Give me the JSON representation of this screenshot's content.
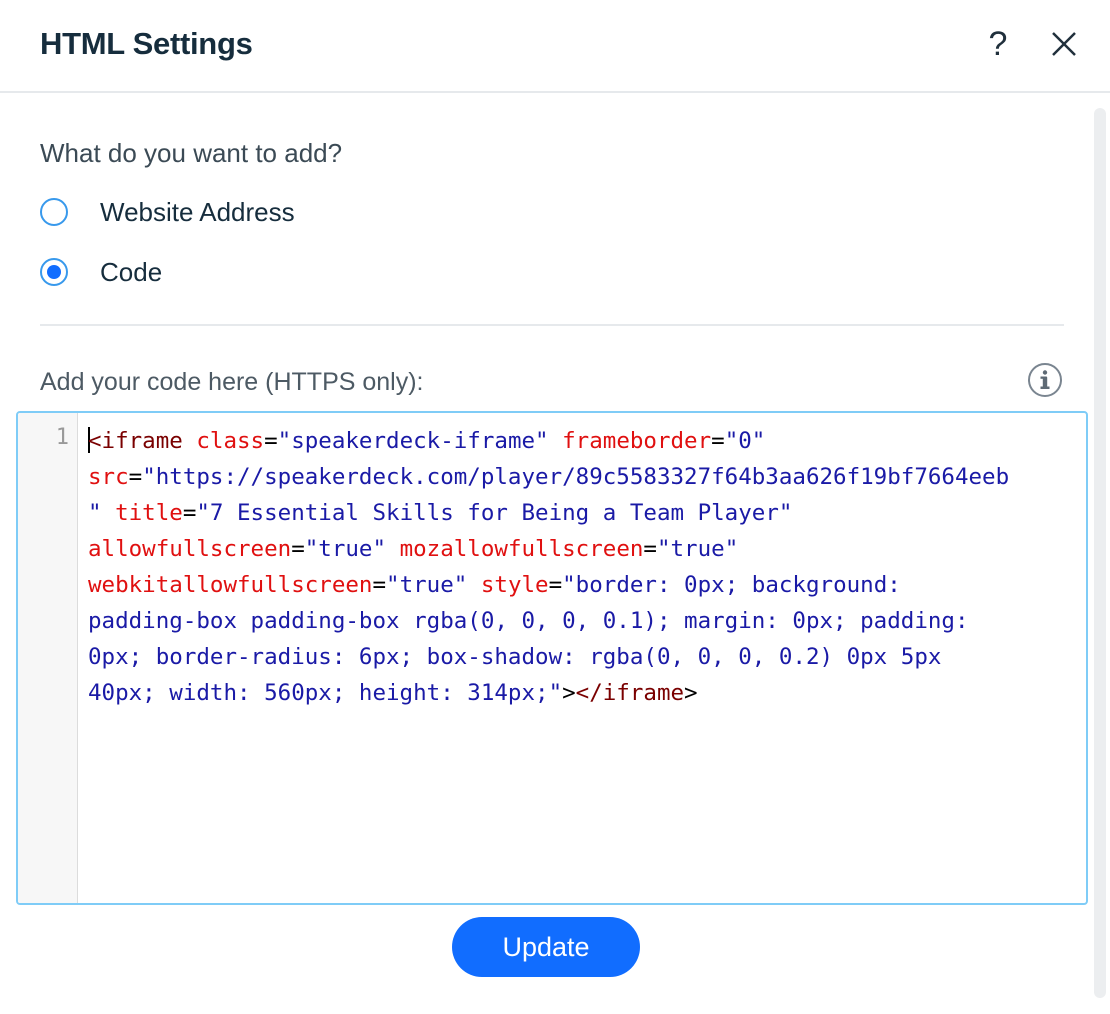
{
  "dialog": {
    "title": "HTML Settings",
    "help_icon": "question-icon",
    "help_label": "?",
    "close_icon": "close-icon"
  },
  "content": {
    "question": "What do you want to add?",
    "options": [
      {
        "label": "Website Address",
        "selected": false
      },
      {
        "label": "Code",
        "selected": true
      }
    ],
    "code_label": "Add your code here (HTTPS only):",
    "info_icon": "info-icon"
  },
  "editor": {
    "line_number": "1",
    "lines": [
      [
        {
          "t": "tag",
          "v": "<iframe"
        },
        {
          "t": "punct",
          "v": " "
        },
        {
          "t": "attr",
          "v": "class"
        },
        {
          "t": "punct",
          "v": "="
        },
        {
          "t": "str",
          "v": "\"speakerdeck-iframe\""
        },
        {
          "t": "punct",
          "v": " "
        },
        {
          "t": "attr",
          "v": "frameborder"
        },
        {
          "t": "punct",
          "v": "="
        },
        {
          "t": "str",
          "v": "\"0\""
        }
      ],
      [
        {
          "t": "attr",
          "v": "src"
        },
        {
          "t": "punct",
          "v": "="
        },
        {
          "t": "str",
          "v": "\"https://speakerdeck.com/player/89c5583327f64b3aa626f19bf7664eeb"
        }
      ],
      [
        {
          "t": "str",
          "v": "\""
        },
        {
          "t": "punct",
          "v": " "
        },
        {
          "t": "attr",
          "v": "title"
        },
        {
          "t": "punct",
          "v": "="
        },
        {
          "t": "str",
          "v": "\"7 Essential Skills for Being a Team Player\""
        }
      ],
      [
        {
          "t": "attr",
          "v": "allowfullscreen"
        },
        {
          "t": "punct",
          "v": "="
        },
        {
          "t": "str",
          "v": "\"true\""
        },
        {
          "t": "punct",
          "v": " "
        },
        {
          "t": "attr",
          "v": "mozallowfullscreen"
        },
        {
          "t": "punct",
          "v": "="
        },
        {
          "t": "str",
          "v": "\"true\""
        }
      ],
      [
        {
          "t": "attr",
          "v": "webkitallowfullscreen"
        },
        {
          "t": "punct",
          "v": "="
        },
        {
          "t": "str",
          "v": "\"true\""
        },
        {
          "t": "punct",
          "v": " "
        },
        {
          "t": "attr",
          "v": "style"
        },
        {
          "t": "punct",
          "v": "="
        },
        {
          "t": "str",
          "v": "\"border: 0px; background:"
        }
      ],
      [
        {
          "t": "str",
          "v": "padding-box padding-box rgba(0, 0, 0, 0.1); margin: 0px; padding:"
        }
      ],
      [
        {
          "t": "str",
          "v": "0px; border-radius: 6px; box-shadow: rgba(0, 0, 0, 0.2) 0px 5px"
        }
      ],
      [
        {
          "t": "str",
          "v": "40px; width: 560px; height: 314px;\""
        },
        {
          "t": "punct",
          "v": ">"
        },
        {
          "t": "tag",
          "v": "</iframe"
        },
        {
          "t": "punct",
          "v": ">"
        }
      ]
    ]
  },
  "footer": {
    "update_label": "Update"
  },
  "colors": {
    "accent": "#116dff",
    "radio_border": "#3899ec",
    "editor_border": "#7fccf7",
    "tag": "#7a0000",
    "attr": "#e01010",
    "string": "#1a1aa6"
  }
}
